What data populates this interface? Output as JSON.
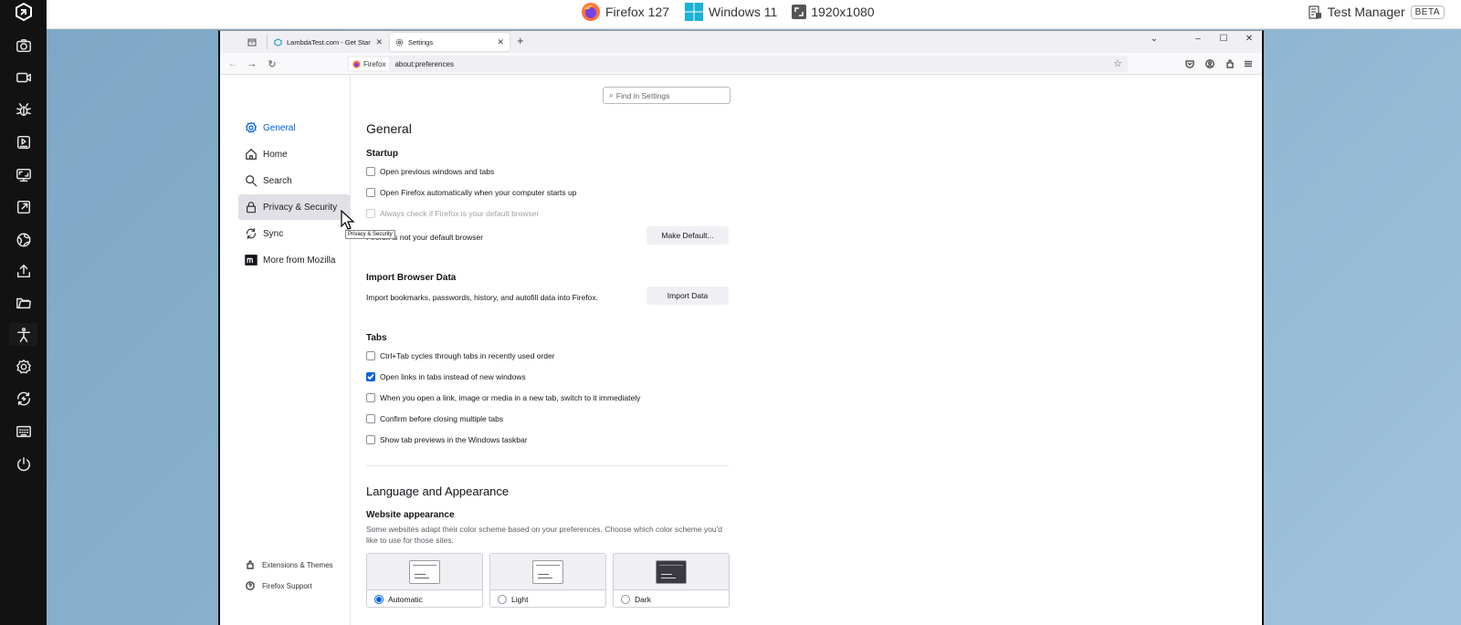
{
  "topbar": {
    "browser": "Firefox 127",
    "os": "Windows 11",
    "resolution": "1920x1080",
    "test_manager": "Test Manager",
    "beta_badge": "BETA"
  },
  "lt_sidebar": {
    "icons": [
      "lambdatest-logo-icon",
      "camera-icon",
      "video-icon",
      "bug-icon",
      "play-screen-icon",
      "monitor-resize-icon",
      "open-external-icon",
      "globe-icon",
      "upload-icon",
      "folder-icon",
      "accessibility-icon",
      "settings-icon",
      "sync-icon",
      "keyboard-icon",
      "power-icon"
    ]
  },
  "browser": {
    "tabs": [
      {
        "title": "LambdaTest.com - Get Started",
        "icon": "lambdatest-icon",
        "active": false
      },
      {
        "title": "Settings",
        "icon": "gear-icon",
        "active": true
      }
    ],
    "identity_label": "Firefox",
    "url": "about:preferences"
  },
  "categories": {
    "items": [
      {
        "label": "General",
        "icon": "gear-icon",
        "selected": true
      },
      {
        "label": "Home",
        "icon": "home-icon"
      },
      {
        "label": "Search",
        "icon": "search-icon"
      },
      {
        "label": "Privacy & Security",
        "icon": "lock-icon",
        "hovered": true
      },
      {
        "label": "Sync",
        "icon": "sync-icon"
      },
      {
        "label": "More from Mozilla",
        "icon": "mozilla-icon"
      }
    ],
    "footer": [
      {
        "label": "Extensions & Themes",
        "icon": "extensions-icon"
      },
      {
        "label": "Firefox Support",
        "icon": "help-icon"
      }
    ],
    "tooltip": "Privacy & Security"
  },
  "prefs": {
    "search_placeholder": "Find in Settings",
    "title": "General",
    "startup": {
      "heading": "Startup",
      "options": [
        {
          "label": "Open previous windows and tabs",
          "checked": false
        },
        {
          "label": "Open Firefox automatically when your computer starts up",
          "checked": false
        },
        {
          "label": "Always check if Firefox is your default browser",
          "checked": false,
          "disabled": true
        }
      ],
      "default_status": "Firefox is not your default browser",
      "make_default_button": "Make Default..."
    },
    "import": {
      "heading": "Import Browser Data",
      "description": "Import bookmarks, passwords, history, and autofill data into Firefox.",
      "button": "Import Data"
    },
    "tabs": {
      "heading": "Tabs",
      "options": [
        {
          "label": "Ctrl+Tab cycles through tabs in recently used order",
          "checked": false
        },
        {
          "label": "Open links in tabs instead of new windows",
          "checked": true
        },
        {
          "label": "When you open a link, image or media in a new tab, switch to it immediately",
          "checked": false
        },
        {
          "label": "Confirm before closing multiple tabs",
          "checked": false
        },
        {
          "label": "Show tab previews in the Windows taskbar",
          "checked": false
        }
      ]
    },
    "language": {
      "heading": "Language and Appearance",
      "website_appearance": "Website appearance",
      "description": "Some websites adapt their color scheme based on your preferences. Choose which color scheme you'd like to use for those sites.",
      "choices": [
        {
          "label": "Automatic",
          "selected": true
        },
        {
          "label": "Light",
          "selected": false
        },
        {
          "label": "Dark",
          "selected": false
        }
      ]
    }
  }
}
